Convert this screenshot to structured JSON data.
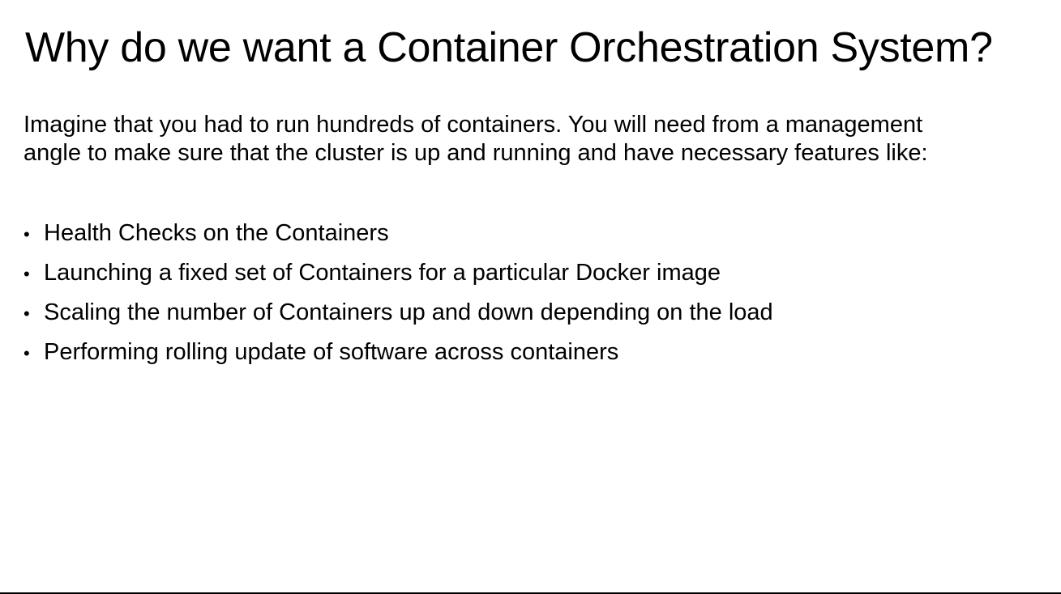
{
  "slide": {
    "title": "Why do we want a Container Orchestration System?",
    "intro_line_1": "Imagine that you had to run hundreds of containers. You will need from a management",
    "intro_line_2": "angle to make sure that the cluster is up and running and have necessary features like:",
    "bullet_glyph": "•",
    "bullets": [
      "Health Checks on the Containers",
      "Launching a fixed set of Containers for a particular Docker image",
      "Scaling the number of Containers up and down depending on the load",
      "Performing rolling update of software across containers"
    ]
  }
}
